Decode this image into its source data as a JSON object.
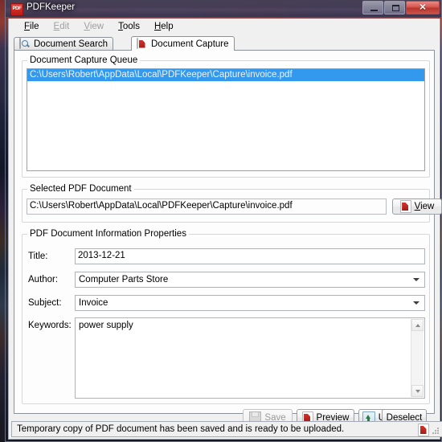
{
  "window": {
    "title": "PDFKeeper",
    "app_icon": "pdf-app-icon",
    "buttons": {
      "minimize": "minimize-icon",
      "maximize": "maximize-icon",
      "close": "✕"
    }
  },
  "menubar": {
    "items": [
      {
        "label": "File",
        "accel": "F",
        "enabled": true
      },
      {
        "label": "Edit",
        "accel": "E",
        "enabled": false
      },
      {
        "label": "View",
        "accel": "V",
        "enabled": false
      },
      {
        "label": "Tools",
        "accel": "T",
        "enabled": true
      },
      {
        "label": "Help",
        "accel": "H",
        "enabled": true
      }
    ]
  },
  "tabs": [
    {
      "label": "Document Search",
      "icon": "search-icon",
      "active": false
    },
    {
      "label": "Document Capture",
      "icon": "pdf-icon",
      "active": true
    }
  ],
  "capture_queue": {
    "group_title": "Document Capture Queue",
    "items": [
      {
        "path": "C:\\Users\\Robert\\AppData\\Local\\PDFKeeper\\Capture\\invoice.pdf",
        "selected": true
      }
    ],
    "selection_color": "#3399ee"
  },
  "selected_document": {
    "group_title": "Selected PDF Document",
    "path": "C:\\Users\\Robert\\AppData\\Local\\PDFKeeper\\Capture\\invoice.pdf",
    "view_button": {
      "label": "View",
      "accel": "V",
      "icon": "pdf-icon"
    }
  },
  "properties": {
    "group_title": "PDF Document Information Properties",
    "fields": [
      {
        "label": "Title:",
        "value": "2013-12-21",
        "type": "text"
      },
      {
        "label": "Author:",
        "value": "Computer Parts Store",
        "type": "combo"
      },
      {
        "label": "Subject:",
        "value": "Invoice",
        "type": "combo"
      },
      {
        "label": "Keywords:",
        "value": "power supply",
        "type": "memo"
      }
    ]
  },
  "actions": [
    {
      "label": "Save",
      "accel": "S",
      "icon": "save-icon",
      "enabled": false
    },
    {
      "label": "Preview",
      "accel": "P",
      "icon": "pdf-icon",
      "enabled": true
    },
    {
      "label": "Upload",
      "accel": "U",
      "icon": "upload-icon",
      "enabled": true
    },
    {
      "label": "Deselect",
      "accel": "D",
      "icon": "",
      "enabled": true
    }
  ],
  "statusbar": {
    "message": "Temporary copy of PDF document has been saved and is ready to be uploaded.",
    "icon": "pdf-icon",
    "grip": "resize-grip-icon"
  }
}
